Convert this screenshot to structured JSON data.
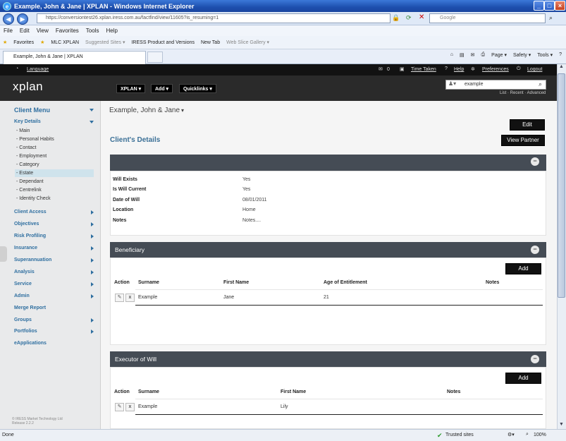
{
  "browser": {
    "window_title": "Example, John & Jane | XPLAN - Windows Internet Explorer",
    "url": "https://conversiontest26.xplan.iress.com.au/factfind/view/11605?is_resuming=1",
    "search_placeholder": "Google",
    "menu": [
      "File",
      "Edit",
      "View",
      "Favorites",
      "Tools",
      "Help"
    ],
    "favorites_label": "Favorites",
    "favorites": [
      "MLC XPLAN",
      "Suggested Sites ▾",
      "IRESS Product and Versions",
      "New Tab",
      "Web Slice Gallery ▾"
    ],
    "tab_title": "Example, John & Jane | XPLAN",
    "commands": [
      "Page ▾",
      "Safety ▾",
      "Tools ▾"
    ],
    "status_left": "Done",
    "status_zone": "Trusted sites",
    "zoom": "100%"
  },
  "topstrip": {
    "language": "Language",
    "msg_count": "0",
    "time_taken": "Time Taken",
    "help": "Help",
    "preferences": "Preferences",
    "logout": "Logout"
  },
  "header": {
    "logo": "xplan",
    "menus": [
      "XPLAN ▾",
      "Add ▾",
      "Quicklinks ▾"
    ],
    "search_value": "example",
    "search_links": "List · Recent · Advanced"
  },
  "sidebar": {
    "client_menu": "Client Menu",
    "key_details": "Key Details",
    "sub_items": [
      "- Main",
      "- Personal Habits",
      "- Contact",
      "- Employment",
      "- Category",
      "- Estate",
      "- Dependant",
      "- Centrelink",
      "- Identity Check"
    ],
    "sections": [
      "Client Access",
      "Objectives",
      "Risk Profiling",
      "Insurance",
      "Superannuation",
      "Analysis",
      "Service",
      "Admin",
      "Merge Report",
      "Groups",
      "Portfolios",
      "eApplications"
    ],
    "footer1": "© IRESS Market Technology Ltd",
    "footer2": "Release 2.2.2"
  },
  "main": {
    "client_name": "Example, John & Jane",
    "edit": "Edit",
    "section_title": "Client's Details",
    "view_partner": "View Partner",
    "estate": {
      "fields": [
        {
          "label": "Will Exists",
          "value": "Yes"
        },
        {
          "label": "Is Will Current",
          "value": "Yes"
        },
        {
          "label": "Date of Will",
          "value": "08/01/2011"
        },
        {
          "label": "Location",
          "value": "Home"
        },
        {
          "label": "Notes",
          "value": "Notes...."
        }
      ]
    },
    "beneficiary": {
      "title": "Beneficiary",
      "add": "Add",
      "headers": [
        "Action",
        "Surname",
        "First Name",
        "Age of Entitlement",
        "Notes"
      ],
      "row": {
        "surname": "Example",
        "first_name": "Jane",
        "age": "21",
        "notes": ""
      }
    },
    "executor": {
      "title": "Executor of Will",
      "add": "Add",
      "headers": [
        "Action",
        "Surname",
        "First Name",
        "Notes"
      ],
      "row": {
        "surname": "Example",
        "first_name": "Lily",
        "notes": ""
      }
    }
  }
}
